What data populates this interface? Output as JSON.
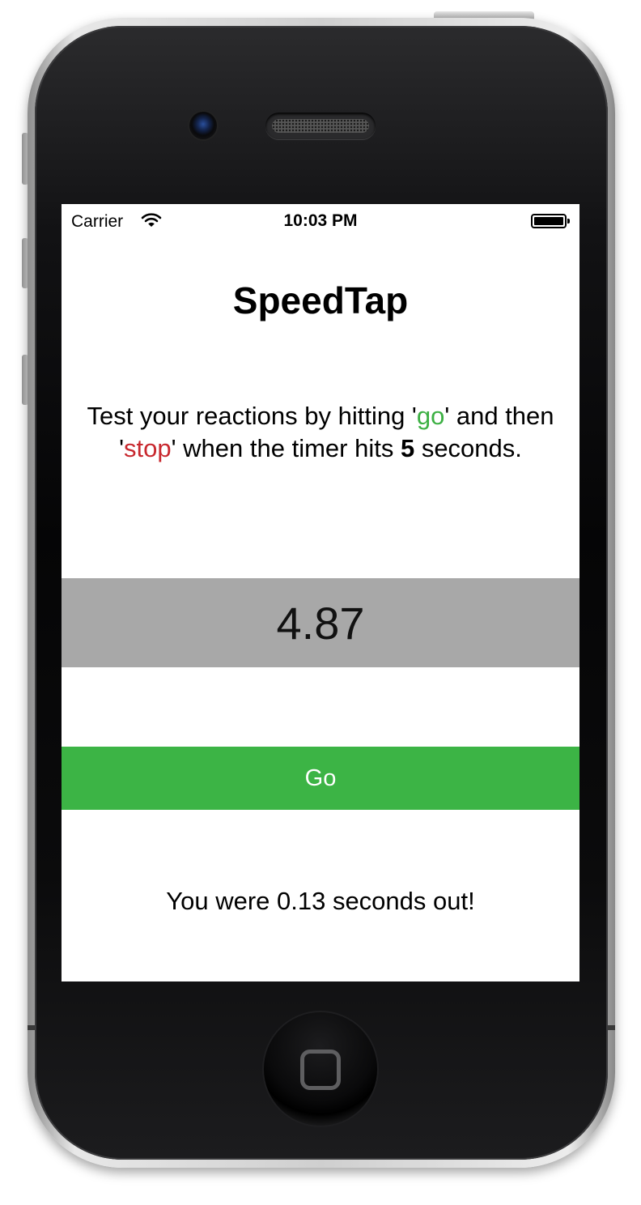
{
  "status_bar": {
    "carrier": "Carrier",
    "time": "10:03 PM",
    "wifi_icon": "wifi-icon",
    "battery_icon": "battery-icon"
  },
  "app": {
    "title": "SpeedTap",
    "instructions": {
      "part1": "Test your reactions by hitting '",
      "go_word": "go",
      "part2": "' and then '",
      "stop_word": "stop",
      "part3": "' when the timer hits ",
      "target": "5",
      "part4": " seconds."
    },
    "timer_value": "4.87",
    "go_button_label": "Go",
    "result_text": "You were 0.13 seconds out!"
  },
  "colors": {
    "go_green": "#3cb445",
    "stop_red": "#c8282e",
    "timer_background": "#a8a8a8",
    "button_text": "#ffffff"
  }
}
